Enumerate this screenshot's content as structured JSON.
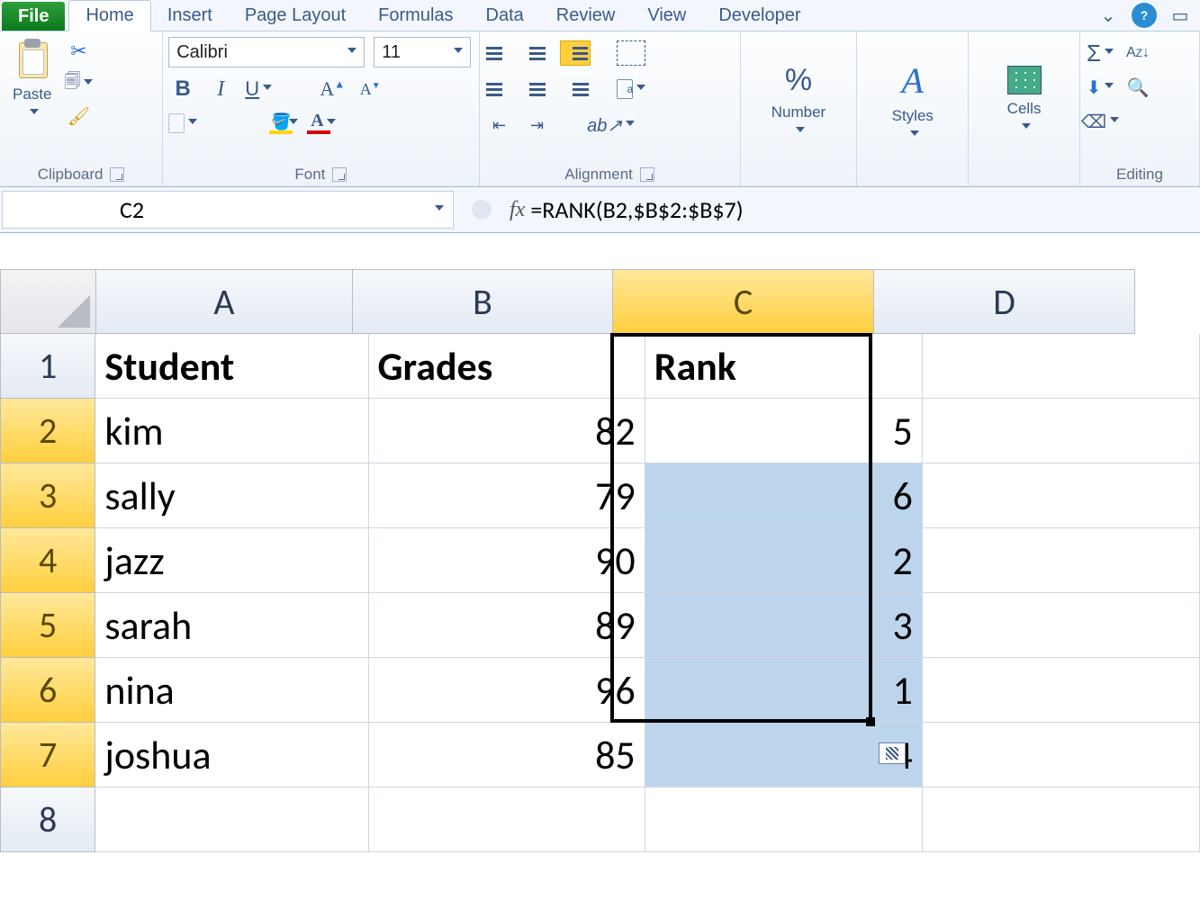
{
  "tabs": {
    "file": "File",
    "items": [
      "Home",
      "Insert",
      "Page Layout",
      "Formulas",
      "Data",
      "Review",
      "View",
      "Developer"
    ],
    "active": "Home"
  },
  "ribbon": {
    "clipboard": {
      "title": "Clipboard",
      "paste": "Paste"
    },
    "font": {
      "title": "Font",
      "name": "Calibri",
      "size": "11",
      "bold": "B",
      "italic": "I",
      "underline": "U"
    },
    "alignment": {
      "title": "Alignment"
    },
    "number": {
      "title": "Number",
      "label": "Number",
      "symbol": "%"
    },
    "styles": {
      "title": "Styles",
      "label": "Styles"
    },
    "cells": {
      "title": "Cells",
      "label": "Cells"
    },
    "editing": {
      "title": "Editing"
    }
  },
  "formula_bar": {
    "name_box": "C2",
    "fx": "fx",
    "formula": "=RANK(B2,$B$2:$B$7)"
  },
  "columns": [
    "A",
    "B",
    "C",
    "D"
  ],
  "rows": [
    "1",
    "2",
    "3",
    "4",
    "5",
    "6",
    "7",
    "8"
  ],
  "headers": {
    "a": "Student",
    "b": "Grades",
    "c": "Rank"
  },
  "data": [
    {
      "student": "kim",
      "grade": "82",
      "rank": "5"
    },
    {
      "student": "sally",
      "grade": "79",
      "rank": "6"
    },
    {
      "student": "jazz",
      "grade": "90",
      "rank": "2"
    },
    {
      "student": "sarah",
      "grade": "89",
      "rank": "3"
    },
    {
      "student": "nina",
      "grade": "96",
      "rank": "1"
    },
    {
      "student": "joshua",
      "grade": "85",
      "rank": "4"
    }
  ],
  "selection": {
    "range": "C2:C7",
    "active": "C2"
  }
}
